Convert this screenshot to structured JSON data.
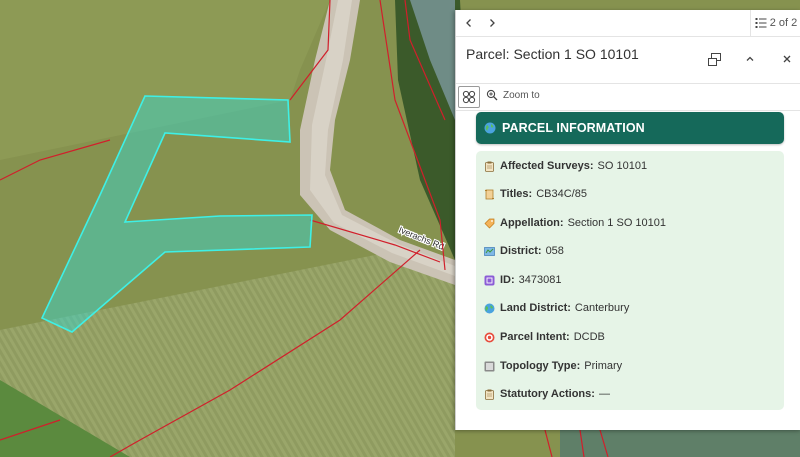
{
  "map": {
    "road_label": "Iverachs Rd",
    "colors": {
      "parcel_fill": "#39d4c8",
      "parcel_outline": "#3ef0e6",
      "boundary": "#d11f2b",
      "road": "#cbc3b5"
    }
  },
  "popup": {
    "icons": {
      "prev": "chevron-left-icon",
      "next": "chevron-right-icon",
      "list": "list-icon",
      "dock": "dock-icon",
      "collapse": "chevron-up-icon",
      "close": "close-icon",
      "features": "feature-grid-icon",
      "zoom": "zoom-to-icon"
    },
    "page_indicator": "2 of 2",
    "title": "Parcel: Section 1 SO 10101",
    "zoom_to_label": "Zoom to",
    "banner_title": "PARCEL INFORMATION",
    "colors": {
      "banner": "#15695a",
      "info_background": "#e6f4e7"
    },
    "fields": [
      {
        "label": "Affected Surveys:",
        "value": "SO 10101",
        "icon": "clipboard-icon"
      },
      {
        "label": "Titles:",
        "value": "CB34C/85",
        "icon": "scroll-icon"
      },
      {
        "label": "Appellation:",
        "value": "Section 1 SO 10101",
        "icon": "tag-icon"
      },
      {
        "label": "District:",
        "value": "058",
        "icon": "map-icon"
      },
      {
        "label": "ID:",
        "value": "3473081",
        "icon": "id-icon"
      },
      {
        "label": "Land District:",
        "value": "Canterbury",
        "icon": "globe-icon"
      },
      {
        "label": "Parcel Intent:",
        "value": "DCDB",
        "icon": "target-icon"
      },
      {
        "label": "Topology Type:",
        "value": "Primary",
        "icon": "square-icon"
      },
      {
        "label": "Statutory Actions:",
        "value": "—",
        "icon": "clipboard-icon"
      }
    ]
  }
}
